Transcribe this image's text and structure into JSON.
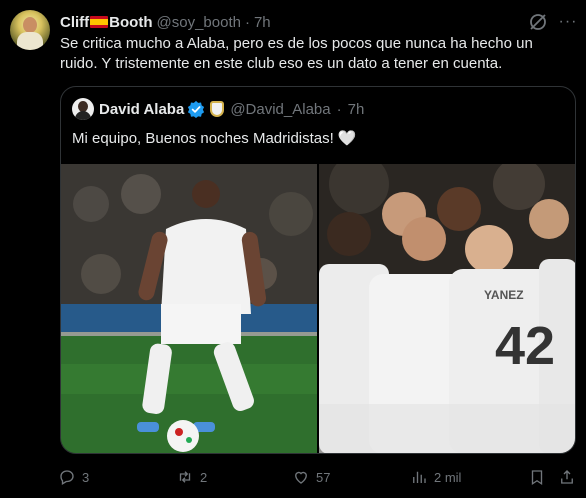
{
  "tweet": {
    "author_name": "Cliff",
    "author_name_suffix": "Booth",
    "handle": "@soy_booth",
    "separator": "·",
    "time": "7h",
    "text": "Se critica mucho a Alaba, pero es de los pocos que nunca ha hecho un ruido. Y tristemente en este club eso es un dato a tener en cuenta.",
    "more_label": "···"
  },
  "quote": {
    "author_name": "David Alaba",
    "handle": "@David_Alaba",
    "separator": "·",
    "time": "7h",
    "text": "Mi equipo, Buenos noches Madridistas!",
    "emoji": "🤍"
  },
  "actions": {
    "replies": "3",
    "reposts": "2",
    "likes": "57",
    "views": "2 mil"
  },
  "icons": {
    "grok": "grok-icon",
    "more": "more-icon",
    "verified": "verified-badge-icon",
    "reply": "reply-icon",
    "repost": "repost-icon",
    "like": "heart-icon",
    "views": "views-icon",
    "bookmark": "bookmark-icon",
    "share": "share-icon"
  },
  "colors": {
    "background": "#000000",
    "text": "#e7e9ea",
    "secondary": "#71767b",
    "verified": "#1d9bf0",
    "border": "#2f3336"
  }
}
